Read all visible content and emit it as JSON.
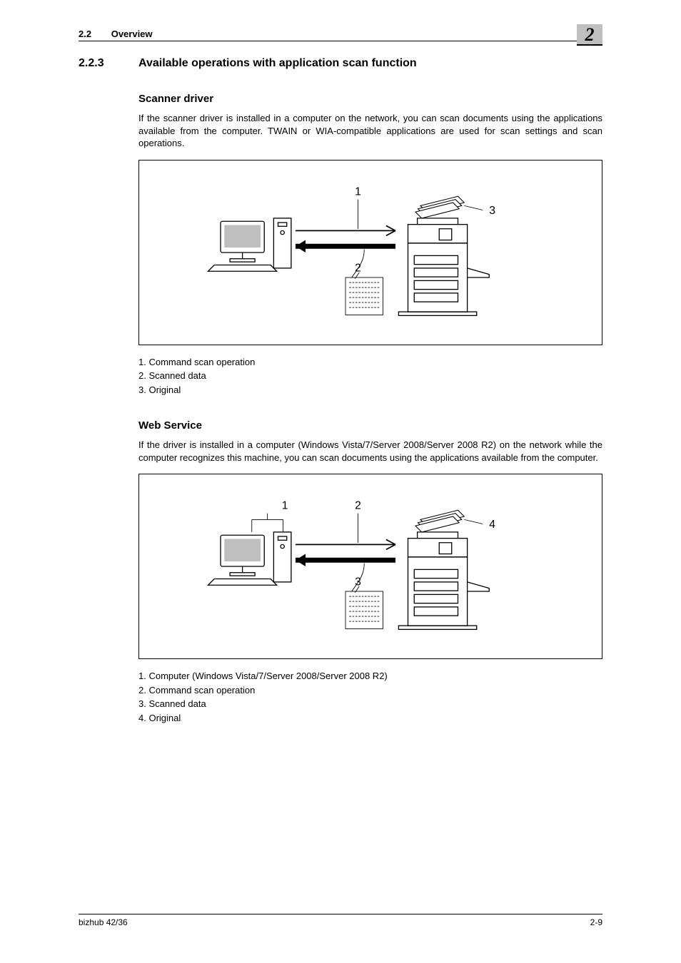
{
  "header": {
    "section_number": "2.2",
    "section_title": "Overview",
    "chapter": "2"
  },
  "section": {
    "number": "2.2.3",
    "title": "Available operations with application scan function"
  },
  "scanner_driver": {
    "heading": "Scanner driver",
    "text": "If the scanner driver is installed in a computer on the network, you can scan documents using the applications available from the computer. TWAIN or WIA-compatible applications are used for scan settings and scan operations.",
    "legend": [
      "1. Command scan operation",
      "2. Scanned data",
      "3. Original"
    ],
    "figure": {
      "labels": {
        "l1": "1",
        "l2": "2",
        "l3": "3"
      }
    }
  },
  "web_service": {
    "heading": "Web Service",
    "text": "If the driver is installed in a computer (Windows Vista/7/Server 2008/Server 2008 R2) on the network while the computer recognizes this machine, you can scan documents using the applications available from the computer.",
    "legend": [
      "1. Computer (Windows Vista/7/Server 2008/Server 2008 R2)",
      "2. Command scan operation",
      "3. Scanned data",
      "4. Original"
    ],
    "figure": {
      "labels": {
        "l1": "1",
        "l2": "2",
        "l3": "3",
        "l4": "4"
      }
    }
  },
  "footer": {
    "model": "bizhub 42/36",
    "page": "2-9"
  }
}
